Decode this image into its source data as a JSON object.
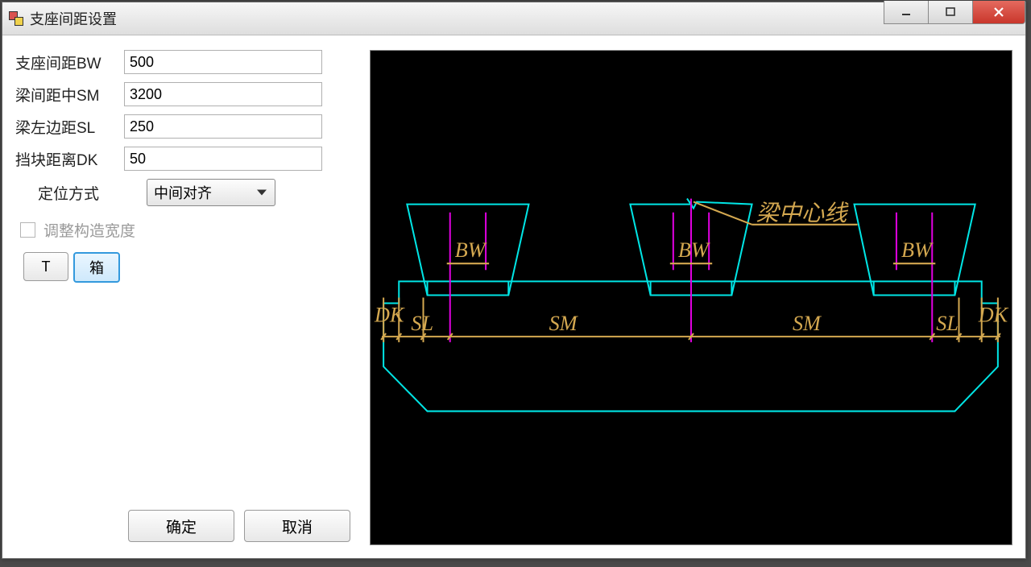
{
  "window": {
    "title": "支座间距设置"
  },
  "form": {
    "bw_label": "支座间距BW",
    "bw_value": "500",
    "sm_label": "梁间距中SM",
    "sm_value": "3200",
    "sl_label": "梁左边距SL",
    "sl_value": "250",
    "dk_label": "挡块距离DK",
    "dk_value": "50",
    "align_label": "定位方式",
    "align_value": "中间对齐",
    "adjust_label": "调整构造宽度",
    "toggle_t": "T",
    "toggle_box": "箱"
  },
  "buttons": {
    "ok": "确定",
    "cancel": "取消"
  },
  "diagram": {
    "bw": "BW",
    "sl": "SL",
    "sm": "SM",
    "dk": "DK",
    "centerline": "梁中心线"
  },
  "colors": {
    "outline": "#00e5e5",
    "dim": "#d4a850",
    "marker": "#e000e0"
  }
}
